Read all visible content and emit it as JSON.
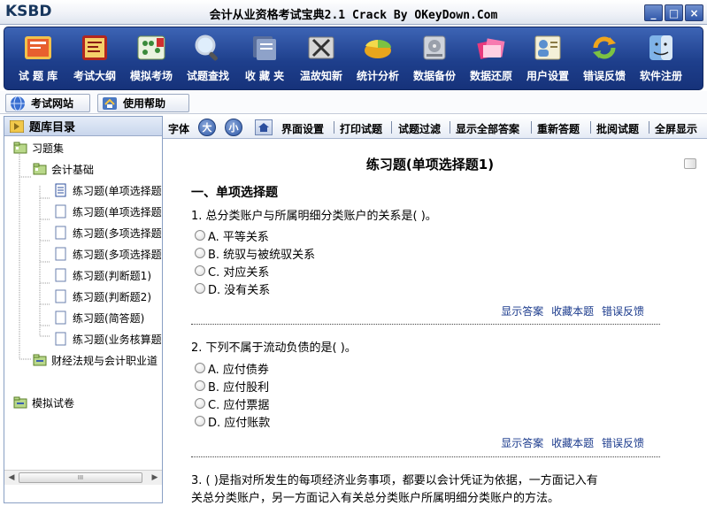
{
  "window": {
    "logo": "KSBD",
    "title": "会计从业资格考试宝典2.1 Crack By OKeyDown.Com",
    "buttons": [
      "_",
      "□",
      "×"
    ]
  },
  "toolbar": {
    "items": [
      {
        "label": "试 题 库",
        "icon": "book-icon"
      },
      {
        "label": "考试大纲",
        "icon": "book-red-icon"
      },
      {
        "label": "模拟考场",
        "icon": "abacus-icon"
      },
      {
        "label": "试题查找",
        "icon": "magnifier-icon"
      },
      {
        "label": "收 藏 夹",
        "icon": "folder-icon"
      },
      {
        "label": "温故知新",
        "icon": "tools-icon"
      },
      {
        "label": "统计分析",
        "icon": "pie-chart-icon"
      },
      {
        "label": "数据备份",
        "icon": "disk-icon"
      },
      {
        "label": "数据还原",
        "icon": "files-icon"
      },
      {
        "label": "用户设置",
        "icon": "user-icon"
      },
      {
        "label": "错误反馈",
        "icon": "refresh-icon"
      },
      {
        "label": "软件注册",
        "icon": "finder-icon"
      }
    ]
  },
  "linkbar": {
    "exam_site": "考试网站",
    "help": "使用帮助"
  },
  "tree": {
    "header": "题库目录",
    "nodes": [
      "习题集",
      "会计基础",
      "练习题(单项选择题",
      "练习题(单项选择题",
      "练习题(多项选择题",
      "练习题(多项选择题",
      "练习题(判断题1)",
      "练习题(判断题2)",
      "练习题(简答题)",
      "练习题(业务核算题",
      "财经法规与会计职业道",
      "模拟试卷"
    ],
    "scroll_thumb": "III"
  },
  "rightbar": {
    "font_label": "字体",
    "font_big": "大",
    "font_small": "小",
    "links": [
      "界面设置",
      "打印试题",
      "试题过滤",
      "显示全部答案",
      "重新答题",
      "批阅试题",
      "全屏显示"
    ]
  },
  "exam": {
    "title": "练习题(单项选择题1)",
    "section": "一、单项选择题",
    "q1": {
      "text": "1. 总分类账户与所属明细分类账户的关系是(   )。",
      "options": [
        "A. 平等关系",
        "B. 统驭与被统驭关系",
        "C. 对应关系",
        "D. 没有关系"
      ]
    },
    "q2": {
      "text": "2. 下列不属于流动负债的是(   )。",
      "options": [
        "A. 应付债券",
        "B. 应付股利",
        "C. 应付票据",
        "D. 应付账款"
      ]
    },
    "q3": {
      "line1": "3. (   )是指对所发生的每项经济业务事项，都要以会计凭证为依据，一方面记入有",
      "line2": "关总分类账户，另一方面记入有关总分类账户所属明细分类账户的方法。"
    },
    "actions": {
      "show_answer": "显示答案",
      "favorite": "收藏本题",
      "report_error": "错误反馈"
    }
  }
}
